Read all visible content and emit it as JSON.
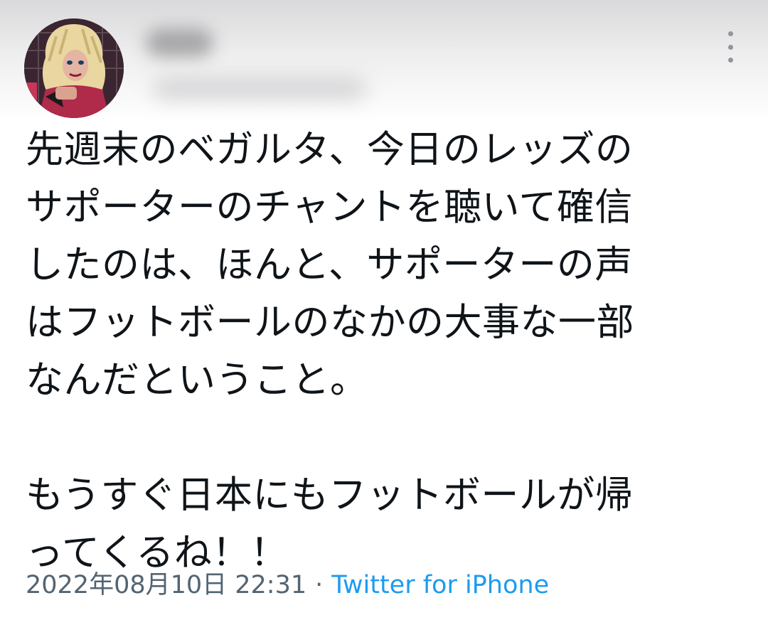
{
  "tweet": {
    "avatar_icon": "user-avatar",
    "more_icon": "more-vertical-icon",
    "text": "先週末のベガルタ、今日のレッズの\nサポーターのチャントを聴いて確信\nしたのは、ほんと、サポーターの声\nはフットボールのなかの大事な一部\nなんだということ。\n\nもうすぐ日本にもフットボールが帰\nってくるね！！",
    "timestamp": "2022年08月10日 22:31",
    "separator": "·",
    "source": "Twitter for iPhone"
  },
  "colors": {
    "text": "#0f1419",
    "meta": "#536471",
    "link": "#1d9bf0"
  }
}
